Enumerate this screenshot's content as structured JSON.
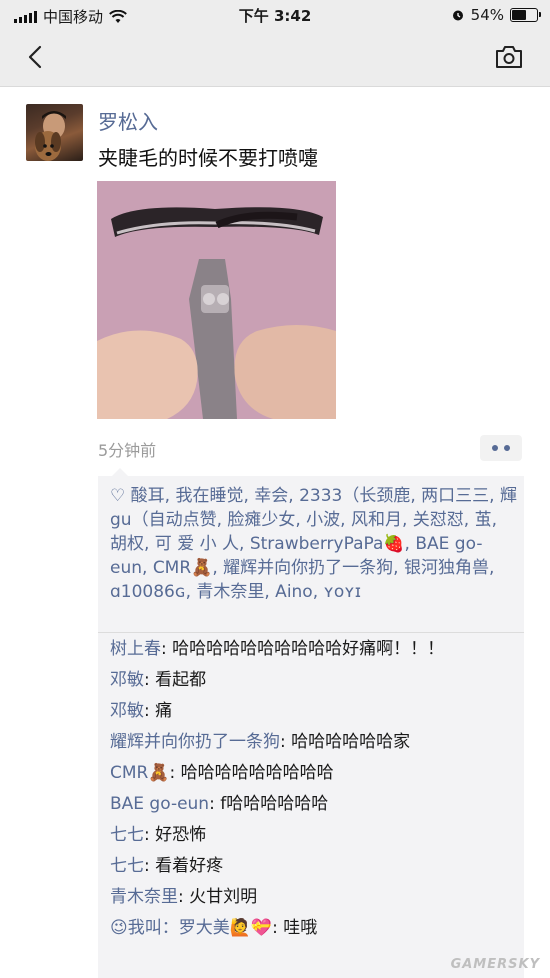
{
  "status_bar": {
    "carrier": "中国移动",
    "time": "下午 3:42",
    "battery": "54%",
    "battery_level": 0.54
  },
  "nav": {
    "back_icon": "chevron-left-icon",
    "camera_icon": "camera-icon"
  },
  "post": {
    "author": "罗松入",
    "text": "夹睫毛的时候不要打喷嚏",
    "timestamp": "5分钟前"
  },
  "likes": {
    "text": "♡ 酸耳, 我在睡觉, 幸会, 2333（长颈鹿, 两口三三, 輝gu（自动点赞, 脸瘫少女, 小波, 风和月, 关怼怼, 茧, 胡权, 可 爱 小 人, StrawberryPaPa🍓, BAE go-eun, CMR🧸, 耀辉并向你扔了一条狗, 银河独角兽, ɑ10086ɢ, 青木奈里, Aino, ʏᴏʏɪ"
  },
  "comments": [
    {
      "name": "树上春",
      "text": ": 哈哈哈哈哈哈哈哈哈哈好痛啊！！！"
    },
    {
      "name": "邓敏",
      "text": ": 看起都"
    },
    {
      "name": "邓敏",
      "text": ": 痛"
    },
    {
      "name": "耀辉并向你扔了一条狗",
      "text": ": 哈哈哈哈哈哈家"
    },
    {
      "name": "CMR🧸",
      "text": ": 哈哈哈哈哈哈哈哈哈"
    },
    {
      "name": "BAE go-eun",
      "text": ": f哈哈哈哈哈哈"
    },
    {
      "name": "七七",
      "text": ": 好恐怖"
    },
    {
      "name": "七七",
      "text": ": 看着好疼"
    },
    {
      "name": "青木奈里",
      "text": ": 火甘刘明"
    },
    {
      "name": "😉我叫：罗大美🙋💝",
      "text": ": 哇哦"
    }
  ],
  "watermark": "GAMERSKY"
}
